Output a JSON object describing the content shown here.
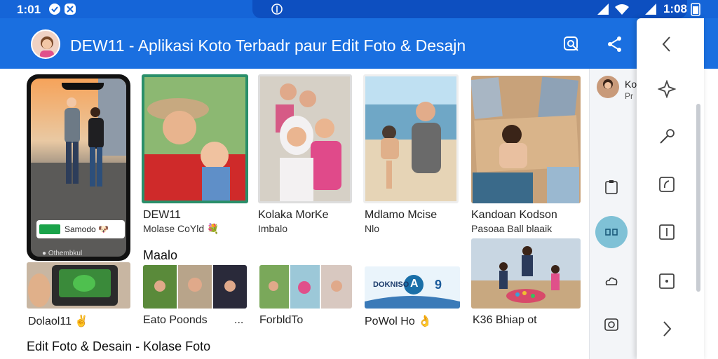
{
  "statusbar": {
    "time_left": "1:01",
    "time_right": "1:08"
  },
  "appbar": {
    "title": "DEW11 - Aplikasi Koto Terbadr paur Edit Foto & Desajn"
  },
  "cards_row1": [
    {
      "title": "DEW11",
      "subtitle": "Molase CoYld 💐"
    },
    {
      "title": "Kolaka MorKe",
      "subtitle": "Imbalo"
    },
    {
      "title": "Mdlamo Mcise",
      "subtitle": "Nlo"
    },
    {
      "title": "Kandoan Kodson",
      "subtitle": "Pasoaa Ball blaaik"
    }
  ],
  "phone": {
    "banner_text": "Samodo 🐶",
    "footer_text": "● Othembkul"
  },
  "section": {
    "label": "Maalo"
  },
  "cards_row2": [
    {
      "title": "Dolaol11 ✌"
    },
    {
      "title": "Eato Poonds"
    },
    {
      "title": "ForbldTo"
    },
    {
      "title": "PoWol Ho 👌"
    },
    {
      "title": "K36 Bhiap ot"
    }
  ],
  "row2_more": "...",
  "footer_section": {
    "label": "Edit Foto & Desain - Kolase Foto"
  },
  "app_banner": {
    "text": "DOKNISO",
    "number": "9",
    "badge": "A"
  },
  "rightpanel": {
    "name": "Ko",
    "sub": "Pr"
  },
  "colors": {
    "primary": "#1a6fe0",
    "statusbar": "#1565d8",
    "accent_green": "#1aa34a"
  }
}
